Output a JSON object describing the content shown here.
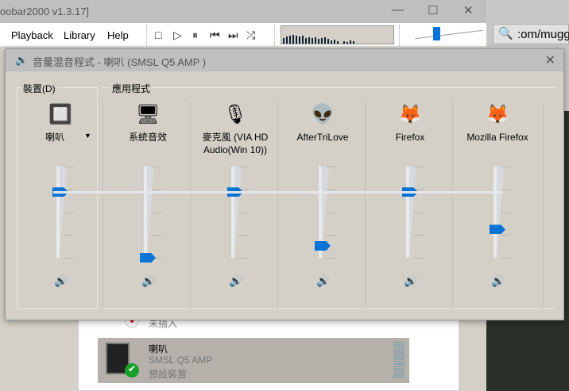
{
  "foobar": {
    "title": "oobar2000 v1.3.17]",
    "menu": [
      "Playback",
      "Library",
      "Help"
    ],
    "toolbar_icons": [
      "stop-icon",
      "play-icon",
      "pause-icon",
      "previous-icon",
      "next-icon",
      "random-icon"
    ]
  },
  "browser": {
    "url": ":om/mugg"
  },
  "mixer": {
    "title": "音量混音程式 - 喇叭 (SMSL Q5 AMP )",
    "device_group": "裝置(D)",
    "apps_group": "應用程式",
    "accent": "#0a74d6",
    "device": {
      "label": "喇叭",
      "icon": "speaker-icon",
      "volume": 72
    },
    "apps": [
      {
        "label": "系統音效",
        "icon": "system-sounds-icon",
        "volume": 0
      },
      {
        "label": "麥克風 (VIA HD Audio(Win 10))",
        "icon": "microphone-icon",
        "volume": 72
      },
      {
        "label": "AfterTriLove",
        "icon": "foobar-alien-icon",
        "volume": 13
      },
      {
        "label": "Firefox",
        "icon": "firefox-icon",
        "volume": 72
      },
      {
        "label": "Mozilla Firefox",
        "icon": "firefox-icon",
        "volume": 31
      }
    ]
  },
  "sound_panel": {
    "items": [
      {
        "status": "未插入"
      },
      {
        "name": "喇叭",
        "device": "SMSL Q5 AMP",
        "status": "預設裝置"
      }
    ]
  }
}
